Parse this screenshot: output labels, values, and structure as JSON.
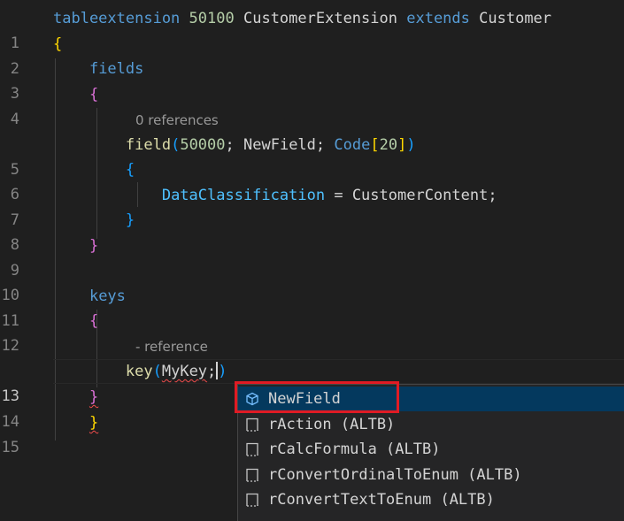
{
  "line_numbers": [
    "1",
    "2",
    "3",
    "4",
    "5",
    "6",
    "7",
    "8",
    "9",
    "10",
    "11",
    "12",
    "13",
    "14",
    "15"
  ],
  "code": {
    "l1": {
      "kw": "tableextension",
      "num": "50100",
      "name": "CustomerExtension",
      "ext": "extends",
      "base": "Customer"
    },
    "l2": {
      "brace": "{"
    },
    "l3": {
      "kw": "fields"
    },
    "l4": {
      "brace": "{"
    },
    "hint_fields": "0 references",
    "l5": {
      "fn": "field",
      "open": "(",
      "num": "50000",
      "semi1": ";",
      "name": "NewField",
      "semi2": ";",
      "type": "Code",
      "lb": "[",
      "len": "20",
      "rb": "]",
      "close": ")"
    },
    "l6": {
      "brace": "{"
    },
    "l7": {
      "prop": "DataClassification",
      "eq": "=",
      "value": "CustomerContent;"
    },
    "l8": {
      "brace": "}"
    },
    "l9": {
      "brace": "}"
    },
    "l11": {
      "kw": "keys"
    },
    "l12": {
      "brace": "{"
    },
    "hint_keys": "- reference",
    "l13": {
      "fn": "key",
      "open": "(",
      "name": "MyKey",
      "semi": ";",
      "close": ")"
    },
    "l14": {
      "brace": "}"
    },
    "l15": {
      "brace": "}"
    }
  },
  "suggestions": [
    {
      "label": "NewField",
      "icon": "field-cube-icon",
      "selected": true
    },
    {
      "label": "rAction (ALTB)",
      "icon": "snippet-icon",
      "selected": false
    },
    {
      "label": "rCalcFormula (ALTB)",
      "icon": "snippet-icon",
      "selected": false
    },
    {
      "label": "rConvertOrdinalToEnum (ALTB)",
      "icon": "snippet-icon",
      "selected": false
    },
    {
      "label": "rConvertTextToEnum (ALTB)",
      "icon": "snippet-icon",
      "selected": false
    }
  ],
  "colors": {
    "background": "#1f1f1f",
    "keyword": "#569cd6",
    "number": "#b5cea8",
    "selection": "#04395e",
    "highlight_box": "#e01b24"
  }
}
